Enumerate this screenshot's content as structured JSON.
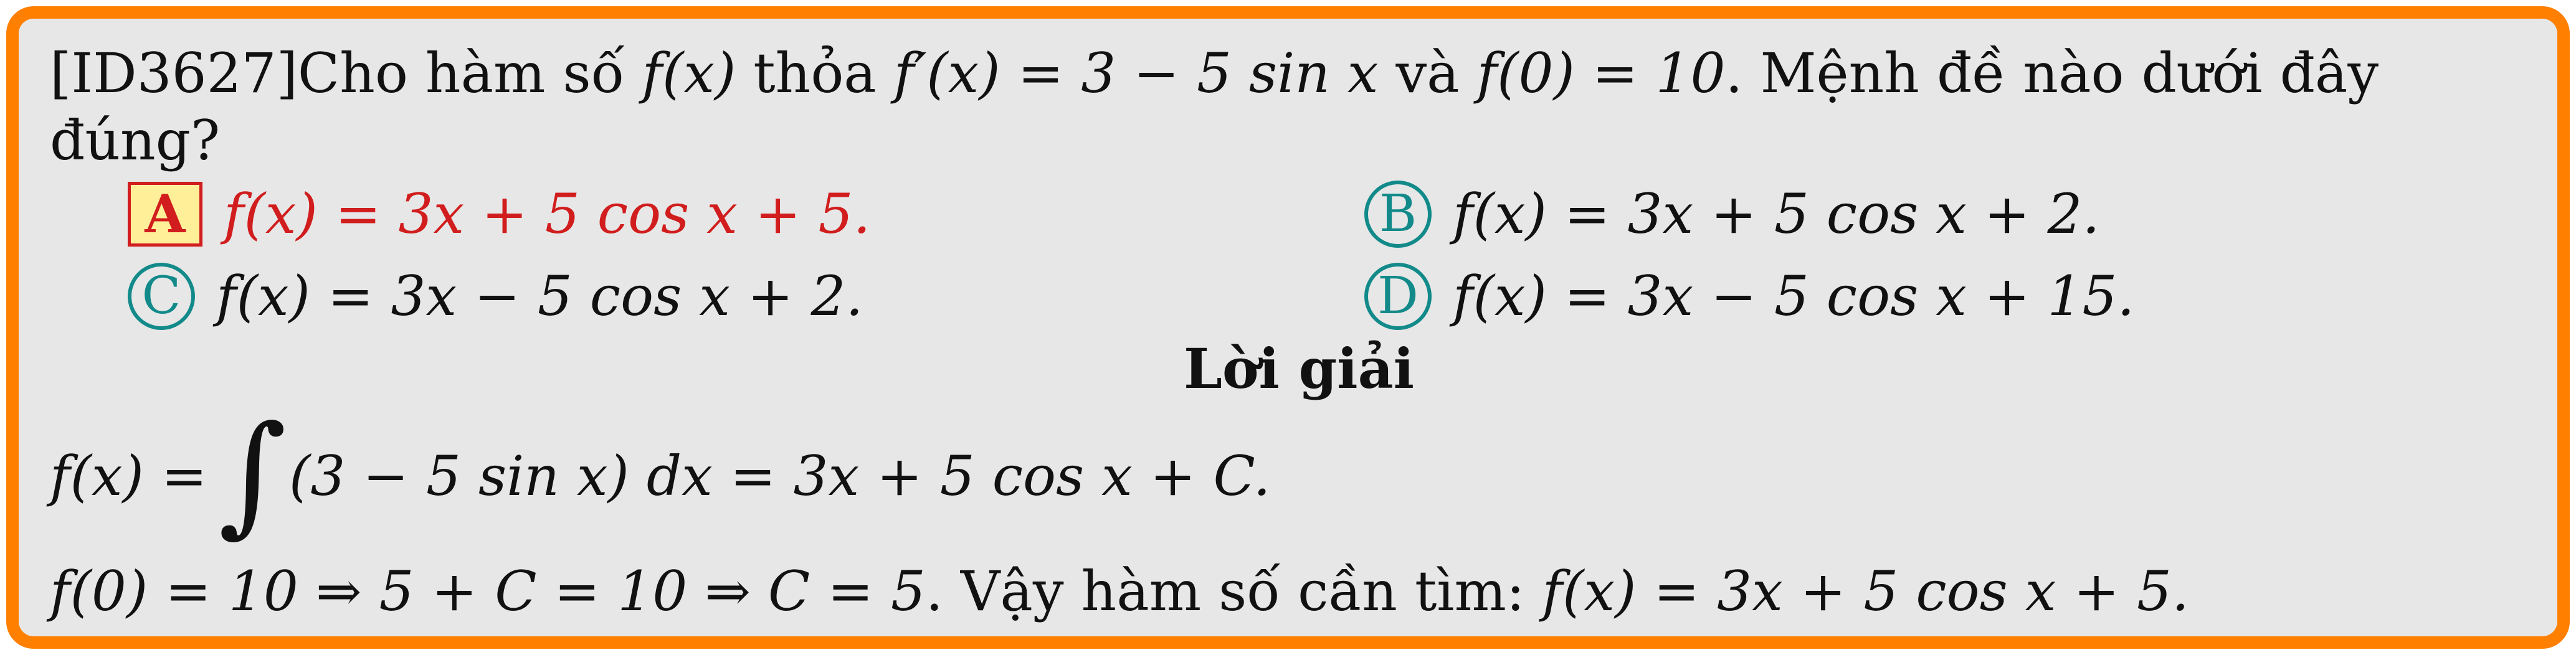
{
  "question": {
    "prefix": "[ID3627]Cho hàm số ",
    "f_x": "f(x)",
    "thoa": " thỏa ",
    "derivative": "f′(x) = 3 − 5 sin x",
    "va": " và ",
    "initial": "f(0) = 10",
    "tail_line1": ". Mệnh đề nào dưới đây",
    "line2": "đúng?"
  },
  "choices": [
    {
      "label": "A",
      "text": "f(x) = 3x + 5 cos x + 5."
    },
    {
      "label": "B",
      "text": "f(x) = 3x + 5 cos x + 2."
    },
    {
      "label": "C",
      "text": "f(x) = 3x − 5 cos x + 2."
    },
    {
      "label": "D",
      "text": "f(x) = 3x − 5 cos x + 15."
    }
  ],
  "solution": {
    "title": "Lời giải",
    "step1_left": "f(x) = ",
    "integral_symbol": "∫",
    "step1_right": "(3 − 5 sin x) dx = 3x + 5 cos x + C.",
    "step2_math": "f(0) = 10 ⇒ 5 + C = 10 ⇒ C = 5",
    "step2_text": ". Vậy hàm số cần tìm: ",
    "step2_answer": "f(x) = 3x + 5 cos x + 5."
  },
  "colors": {
    "border": "#ff7f00",
    "background": "#e7e7e7",
    "correct_answer": "#d11d1d",
    "answer_badge_fill": "#ffef99",
    "option_badge": "#138a8a"
  }
}
